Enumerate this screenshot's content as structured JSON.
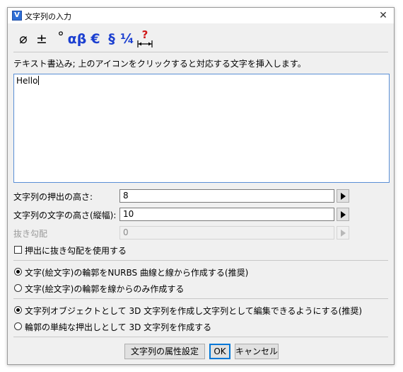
{
  "window": {
    "title": "文字列の入力",
    "app_icon_letter": "V"
  },
  "toolbar": {
    "items": [
      {
        "symbol": "⌀",
        "name": "diameter"
      },
      {
        "symbol": "±",
        "name": "plus-minus"
      },
      {
        "symbol": "°",
        "name": "degree"
      },
      {
        "symbol": "αβ",
        "name": "greek-letters"
      },
      {
        "symbol": "€",
        "name": "euro"
      },
      {
        "symbol": "§",
        "name": "section"
      },
      {
        "symbol": "¼",
        "name": "fraction"
      },
      {
        "symbol": "❓",
        "name": "help"
      }
    ]
  },
  "instruction": "テキスト書込み; 上のアイコンをクリックすると対応する文字を挿入します。",
  "text_value": "Hello",
  "fields": {
    "extrude_height": {
      "label": "文字列の押出の高さ:",
      "value": "8"
    },
    "char_height": {
      "label": "文字列の文字の高さ(縦幅):",
      "value": "10"
    },
    "draft_angle": {
      "label": "抜き勾配",
      "value": "0"
    }
  },
  "use_draft": {
    "label": "押出に抜き勾配を使用する",
    "checked": false
  },
  "outline_options": [
    {
      "label": "文字(絵文字)の輪郭をNURBS 曲線と線から作成する(推奨)",
      "selected": true
    },
    {
      "label": "文字(絵文字)の輪郭を線からのみ作成する",
      "selected": false
    }
  ],
  "object_options": [
    {
      "label": "文字列オブジェクトとして 3D 文字列を作成し文字列として編集できるようにする(推奨)",
      "selected": true
    },
    {
      "label": "輪郭の単純な押出しとして 3D 文字列を作成する",
      "selected": false
    }
  ],
  "buttons": {
    "properties": "文字列の属性設定",
    "ok": "OK",
    "cancel": "キャンセル"
  }
}
